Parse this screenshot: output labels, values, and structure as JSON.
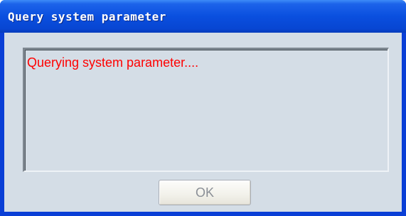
{
  "window": {
    "title": "Query system parameter"
  },
  "memo": {
    "text": "Querying system parameter...."
  },
  "buttons": {
    "ok_label": "OK"
  },
  "colors": {
    "titlebar": "#0a4fdf",
    "client_background": "#d4dde6",
    "status_text": "#ff0000",
    "button_text_disabled": "#8a8f96"
  }
}
